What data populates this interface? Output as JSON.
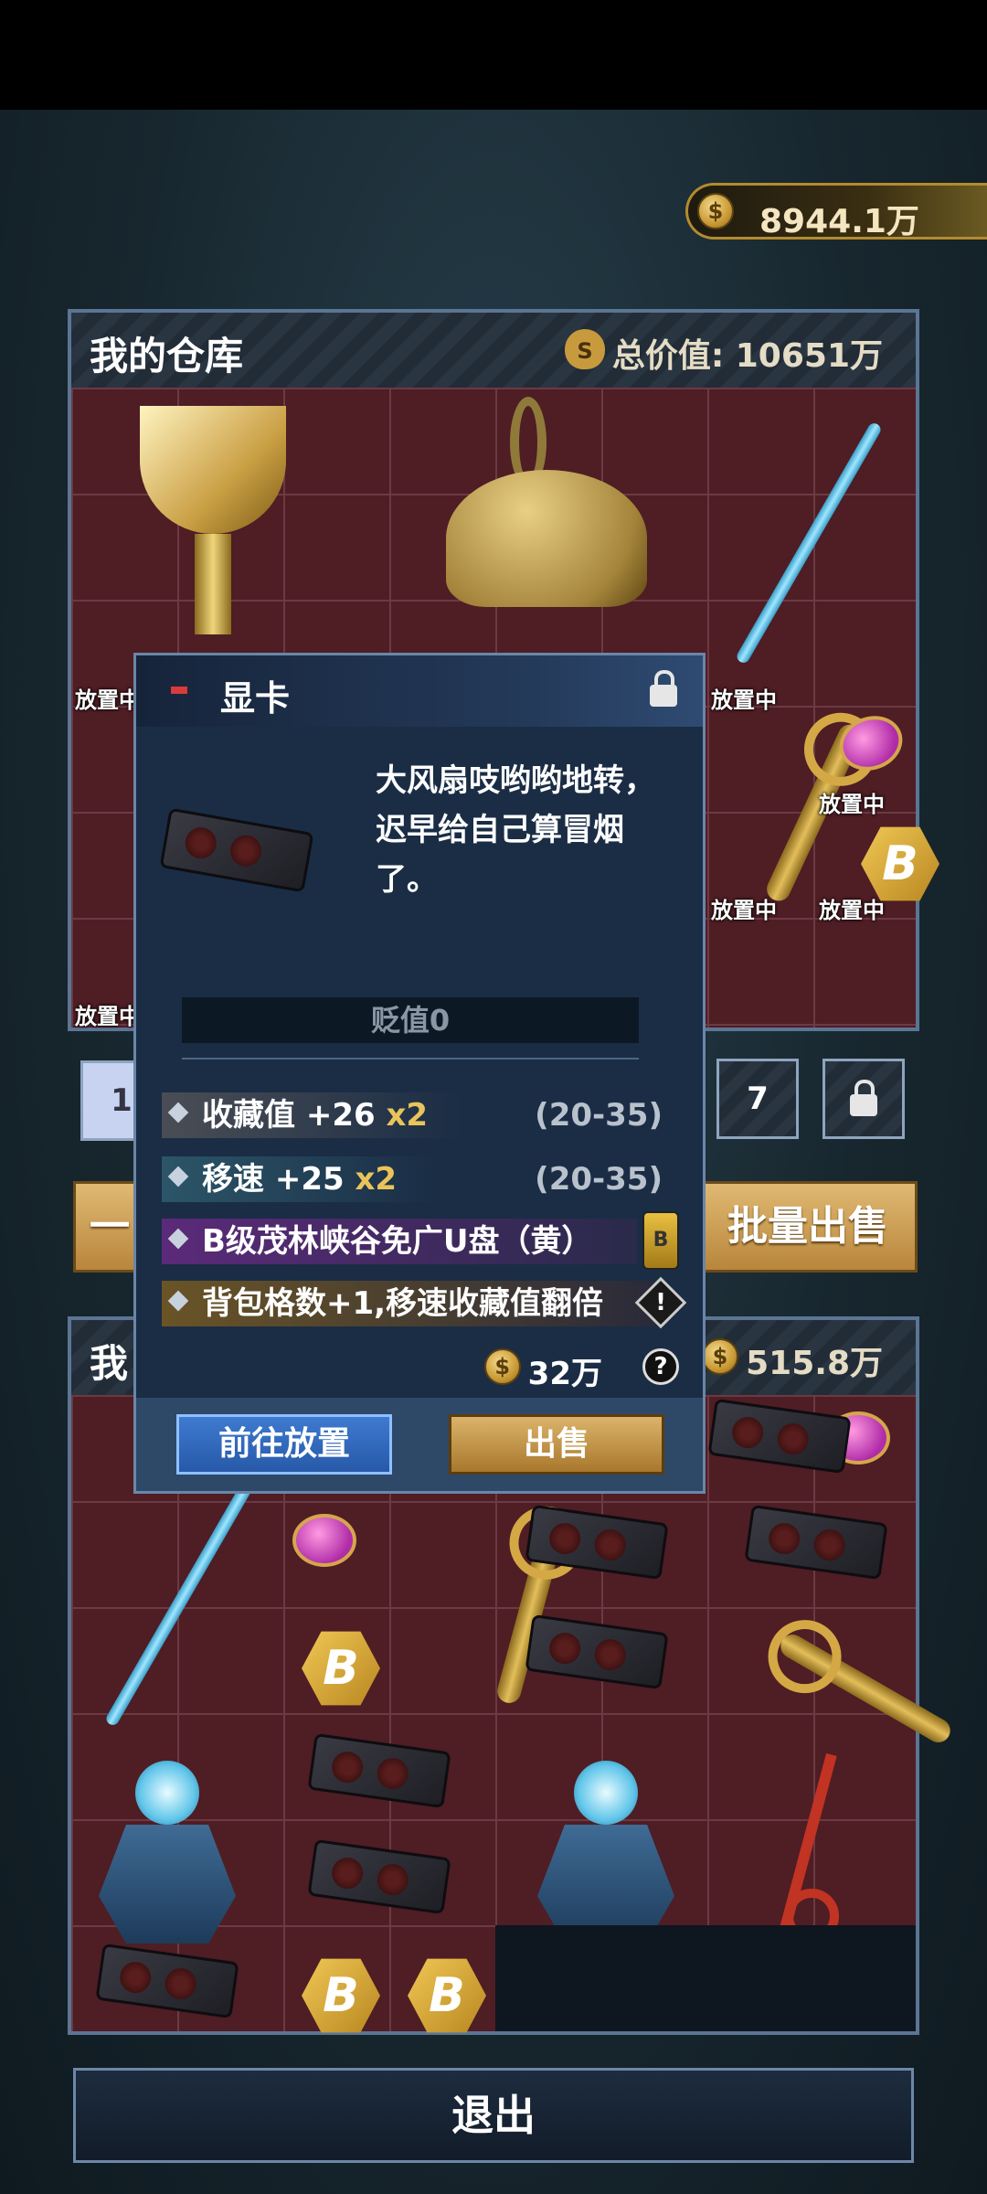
{
  "header": {
    "currency": "8944.1万"
  },
  "warehouse": {
    "title": "我的仓库",
    "total_label": "总价值: 10651万",
    "placing_tag": "放置中",
    "placing_tag_cut": "放置中"
  },
  "controls": {
    "page_first": "1",
    "page_count": "7"
  },
  "actions": {
    "left_btn": "一",
    "batch_sell": "批量出售"
  },
  "backpack": {
    "title": "我",
    "total": "515.8万"
  },
  "popup": {
    "title": "显卡",
    "description": "大风扇吱哟哟地转，迟早给自己算冒烟了。",
    "depreciation": "贬值0",
    "attributes": [
      {
        "name": "收藏值 +26 ",
        "mult": "x2",
        "range": "(20-35)",
        "color": "#4a4d55"
      },
      {
        "name": "移速 +25 ",
        "mult": "x2",
        "range": "(20-35)",
        "color": "#2c5568"
      },
      {
        "name": "B级茂林峡谷免广U盘（黄）",
        "mult": "",
        "range": "",
        "color": "#5b2a7a"
      },
      {
        "name": "背包格数+1,移速收藏值翻倍",
        "mult": "",
        "range": "",
        "color": "#6a5426"
      }
    ],
    "usb_icon": "usb-drive-icon",
    "warn_icon": "!",
    "price": "32万",
    "help": "?",
    "btn_place": "前往放置",
    "btn_sell": "出售"
  },
  "exit": {
    "label": "退出"
  }
}
